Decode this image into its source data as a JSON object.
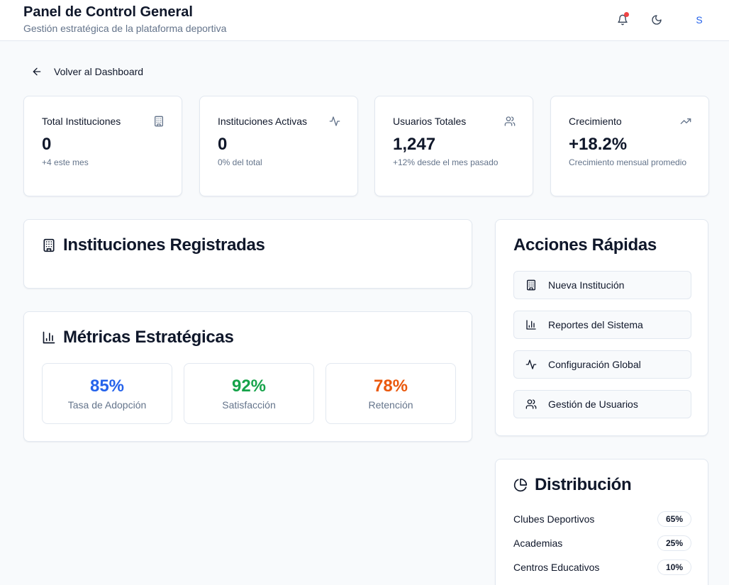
{
  "header": {
    "title": "Panel de Control General",
    "subtitle": "Gestión estratégica de la plataforma deportiva",
    "avatar_initial": "S",
    "icons": [
      "bell-icon",
      "moon-icon"
    ]
  },
  "nav": {
    "back_label": "Volver al Dashboard"
  },
  "stats": [
    {
      "label": "Total Instituciones",
      "value": "0",
      "sub": "+4 este mes",
      "icon": "building-icon"
    },
    {
      "label": "Instituciones Activas",
      "value": "0",
      "sub": "0% del total",
      "icon": "activity-icon"
    },
    {
      "label": "Usuarios Totales",
      "value": "1,247",
      "sub": "+12% desde el mes pasado",
      "icon": "users-icon"
    },
    {
      "label": "Crecimiento",
      "value": "+18.2%",
      "sub": "Crecimiento mensual promedio",
      "icon": "trending-up-icon"
    }
  ],
  "institutions": {
    "title": "Instituciones Registradas"
  },
  "metrics": {
    "title": "Métricas Estratégicas",
    "items": [
      {
        "value": "85%",
        "label": "Tasa de Adopción",
        "color": "#2563eb"
      },
      {
        "value": "92%",
        "label": "Satisfacción",
        "color": "#16a34a"
      },
      {
        "value": "78%",
        "label": "Retención",
        "color": "#ea580c"
      }
    ]
  },
  "actions": {
    "title": "Acciones Rápidas",
    "items": [
      {
        "label": "Nueva Institución",
        "icon": "building-icon"
      },
      {
        "label": "Reportes del Sistema",
        "icon": "bar-chart-icon"
      },
      {
        "label": "Configuración Global",
        "icon": "activity-icon"
      },
      {
        "label": "Gestión de Usuarios",
        "icon": "users-icon"
      }
    ]
  },
  "distribution": {
    "title": "Distribución",
    "items": [
      {
        "label": "Clubes Deportivos",
        "value": "65%"
      },
      {
        "label": "Academias",
        "value": "25%"
      },
      {
        "label": "Centros Educativos",
        "value": "10%"
      }
    ]
  }
}
